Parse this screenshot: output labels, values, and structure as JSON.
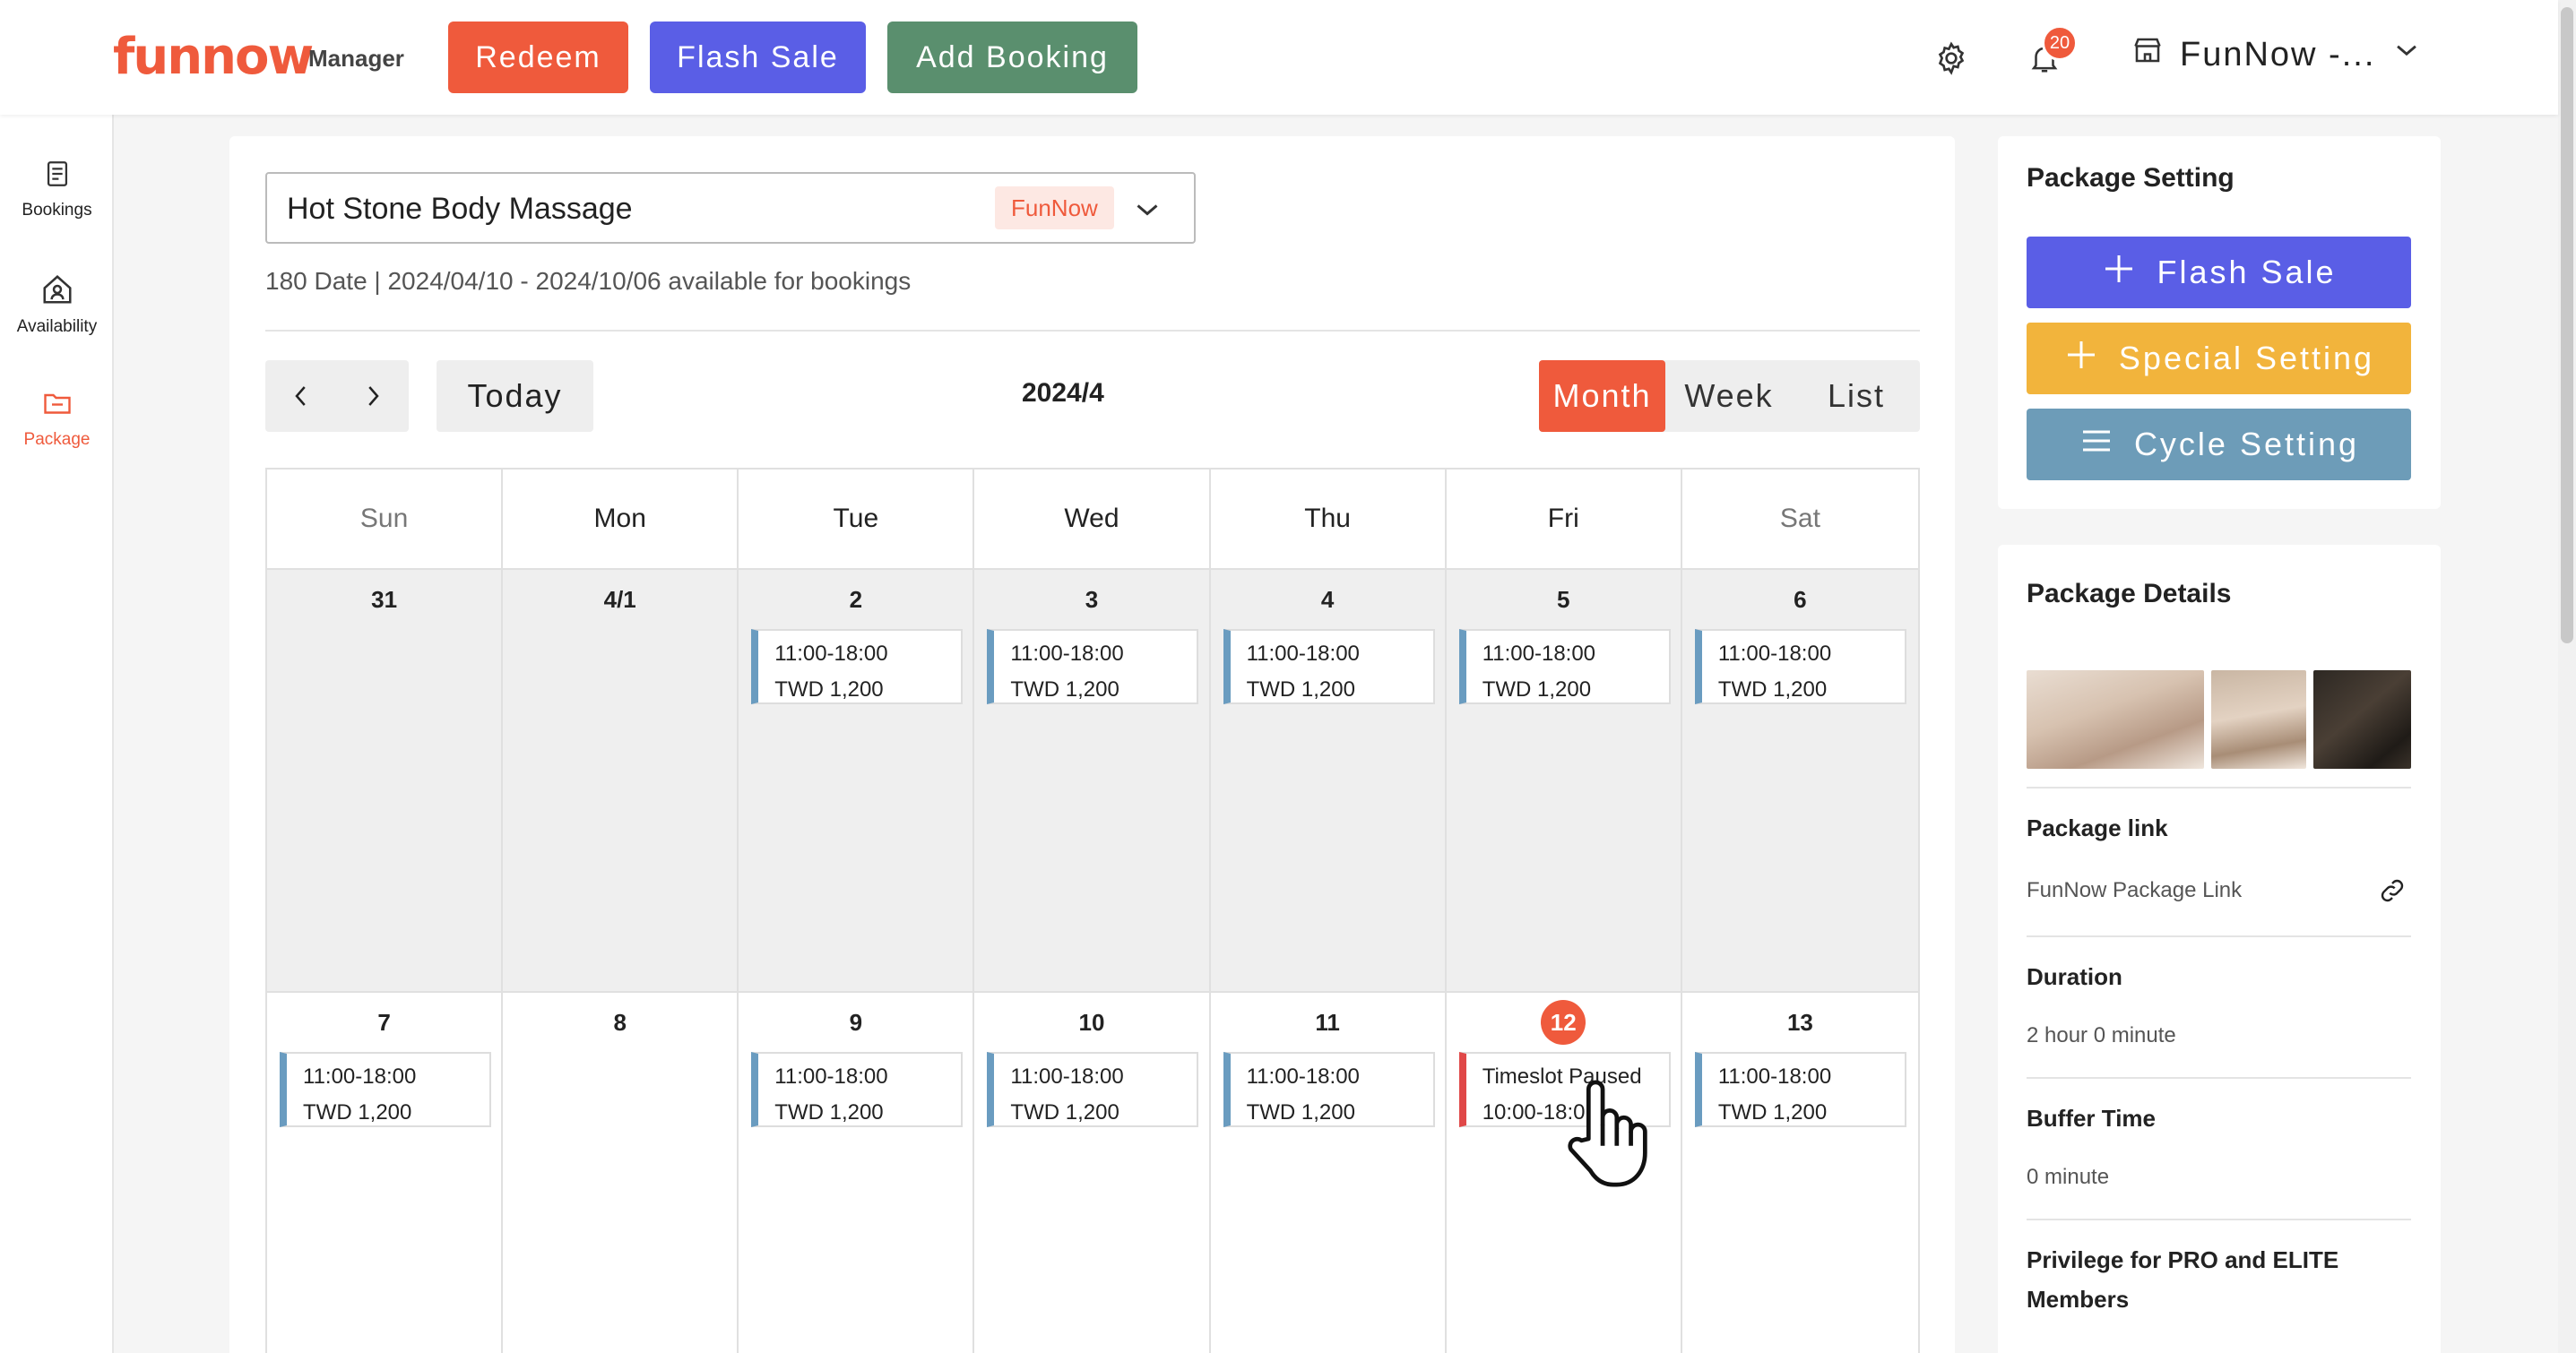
{
  "header": {
    "logo": "funnow",
    "logo_sub": "Manager",
    "redeem_label": "Redeem",
    "flash_sale_label": "Flash Sale",
    "add_booking_label": "Add Booking",
    "notification_count": "20",
    "store_name": "FunNow -..."
  },
  "sidebar": {
    "items": [
      {
        "label": "Bookings",
        "icon": "document-icon"
      },
      {
        "label": "Availability",
        "icon": "person-home-icon"
      },
      {
        "label": "Package",
        "icon": "folder-icon"
      }
    ],
    "active": "Package"
  },
  "calendar": {
    "package_name": "Hot Stone Body Massage",
    "package_tag": "FunNow",
    "availability_note": "180 Date | 2024/04/10 - 2024/10/06 available for bookings",
    "today_label": "Today",
    "title": "2024/4",
    "views": [
      "Month",
      "Week",
      "List"
    ],
    "active_view": "Month",
    "weekdays": [
      "Sun",
      "Mon",
      "Tue",
      "Wed",
      "Thu",
      "Fri",
      "Sat"
    ],
    "weeks": [
      {
        "days": [
          {
            "num": "31",
            "event": null
          },
          {
            "num": "4/1",
            "event": null
          },
          {
            "num": "2",
            "event": {
              "line1": "11:00-18:00",
              "line2": "TWD 1,200"
            }
          },
          {
            "num": "3",
            "event": {
              "line1": "11:00-18:00",
              "line2": "TWD 1,200"
            }
          },
          {
            "num": "4",
            "event": {
              "line1": "11:00-18:00",
              "line2": "TWD 1,200"
            }
          },
          {
            "num": "5",
            "event": {
              "line1": "11:00-18:00",
              "line2": "TWD 1,200"
            }
          },
          {
            "num": "6",
            "event": {
              "line1": "11:00-18:00",
              "line2": "TWD 1,200"
            }
          }
        ]
      },
      {
        "days": [
          {
            "num": "7",
            "event": {
              "line1": "11:00-18:00",
              "line2": "TWD 1,200"
            }
          },
          {
            "num": "8",
            "event": null
          },
          {
            "num": "9",
            "event": {
              "line1": "11:00-18:00",
              "line2": "TWD 1,200"
            }
          },
          {
            "num": "10",
            "event": {
              "line1": "11:00-18:00",
              "line2": "TWD 1,200"
            }
          },
          {
            "num": "11",
            "event": {
              "line1": "11:00-18:00",
              "line2": "TWD 1,200"
            }
          },
          {
            "num": "12",
            "today": true,
            "event": {
              "line1": "Timeslot Paused",
              "line2": "10:00-18:0",
              "paused": true
            }
          },
          {
            "num": "13",
            "event": {
              "line1": "11:00-18:00",
              "line2": "TWD 1,200"
            }
          }
        ]
      }
    ]
  },
  "package_setting": {
    "title": "Package Setting",
    "flash_sale_label": "Flash Sale",
    "special_setting_label": "Special Setting",
    "cycle_setting_label": "Cycle Setting"
  },
  "package_details": {
    "title": "Package Details",
    "link_label": "Package link",
    "link_text": "FunNow Package Link",
    "duration_label": "Duration",
    "duration_value": "2 hour 0 minute",
    "buffer_label": "Buffer Time",
    "buffer_value": "0 minute",
    "privilege_label": "Privilege for PRO and ELITE Members"
  },
  "colors": {
    "brand": "#ef5a3c",
    "flash": "#5a5ee6",
    "add_booking": "#5a8f6e",
    "special": "#f2b43c",
    "cycle": "#6d9cb8",
    "paused": "#e04848",
    "slot": "#6a9cc0"
  }
}
